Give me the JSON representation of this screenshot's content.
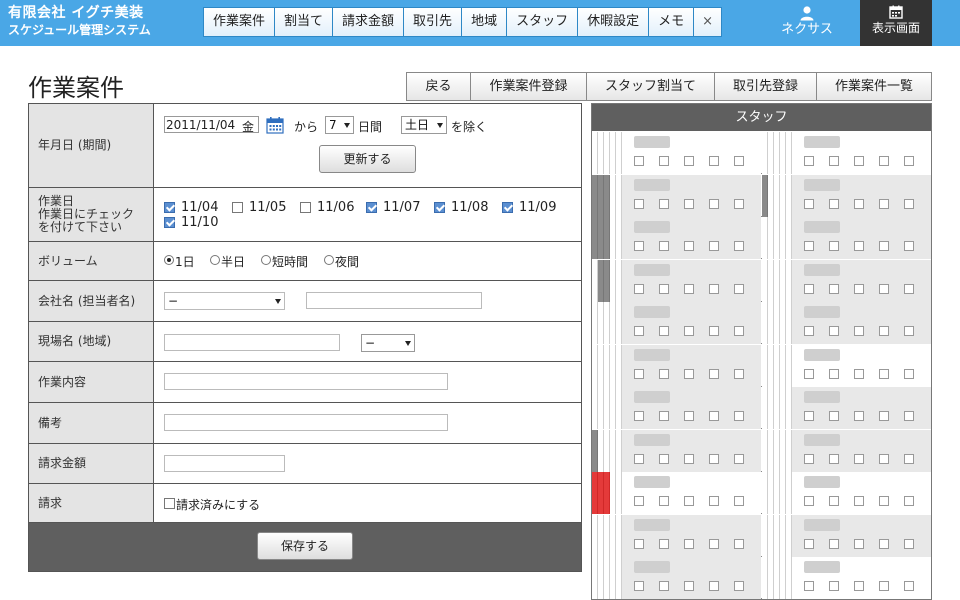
{
  "header": {
    "company": "有限会社 イグチ美装",
    "system": "スケジュール管理システム",
    "nav": [
      "作業案件",
      "割当て",
      "請求金額",
      "取引先",
      "地域",
      "スタッフ",
      "休暇設定",
      "メモ",
      "×"
    ],
    "user": "ネクサス",
    "display_button": "表示画面",
    "colors": {
      "bar": "#4aa7e6",
      "dark": "#333333"
    }
  },
  "page": {
    "title": "作業案件",
    "toolbar": [
      "戻る",
      "作業案件登録",
      "スタッフ割当て",
      "取引先登録",
      "作業案件一覧"
    ]
  },
  "form": {
    "labels": {
      "date": "年月日 (期間)",
      "workday_1": "作業日",
      "workday_2": "作業日にチェック",
      "workday_3": "を付けて下さい",
      "volume": "ボリューム",
      "company": "会社名 (担当者名)",
      "site": "現場名 (地域)",
      "content": "作業内容",
      "note": "備考",
      "amount": "請求金額",
      "billing": "請求"
    },
    "date": {
      "value": "2011/11/04",
      "weekday": "金",
      "from": "から",
      "days": "7",
      "days_unit": "日間",
      "exclude": "土日",
      "exclude_suffix": "を除く",
      "update_button": "更新する"
    },
    "workdays": [
      {
        "label": "11/04",
        "checked": true
      },
      {
        "label": "11/05",
        "checked": false
      },
      {
        "label": "11/06",
        "checked": false
      },
      {
        "label": "11/07",
        "checked": true
      },
      {
        "label": "11/08",
        "checked": true
      },
      {
        "label": "11/09",
        "checked": true
      },
      {
        "label": "11/10",
        "checked": true
      }
    ],
    "volume": [
      {
        "label": "1日",
        "selected": true
      },
      {
        "label": "半日",
        "selected": false
      },
      {
        "label": "短時間",
        "selected": false
      },
      {
        "label": "夜間",
        "selected": false
      }
    ],
    "company_select": "−",
    "site_select": "−",
    "billing_checkbox": "請求済みにする",
    "save_button": "保存する"
  },
  "staff_panel": {
    "title": "スタッフ",
    "checkbox_colors": {
      "dark": "#8a8a8a",
      "red": "#e43a3a"
    },
    "rows": [
      {
        "left": {
          "bars": [
            0,
            0,
            0,
            0,
            0
          ],
          "bg": "white"
        },
        "right": {
          "bars": [
            0,
            0,
            0,
            0,
            0
          ],
          "bg": "white"
        }
      },
      {
        "left": {
          "bars": [
            1,
            1,
            1,
            0,
            0
          ],
          "bg": "gray"
        },
        "right": {
          "bars": [
            1,
            0,
            0,
            0,
            0
          ],
          "bg": "gray"
        }
      },
      {
        "left": {
          "bars": [
            1,
            1,
            1,
            0,
            0
          ],
          "bg": "gray"
        },
        "right": {
          "bars": [
            0,
            0,
            0,
            0,
            0
          ],
          "bg": "gray"
        }
      },
      {
        "left": {
          "bars": [
            0,
            1,
            1,
            0,
            0
          ],
          "bg": "gray"
        },
        "right": {
          "bars": [
            0,
            0,
            0,
            0,
            0
          ],
          "bg": "gray"
        }
      },
      {
        "left": {
          "bars": [
            0,
            0,
            0,
            0,
            0
          ],
          "bg": "gray"
        },
        "right": {
          "bars": [
            0,
            0,
            0,
            0,
            0
          ],
          "bg": "gray"
        }
      },
      {
        "left": {
          "bars": [
            0,
            0,
            0,
            0,
            0
          ],
          "bg": "gray"
        },
        "right": {
          "bars": [
            0,
            0,
            0,
            0,
            0
          ],
          "bg": "white"
        }
      },
      {
        "left": {
          "bars": [
            0,
            0,
            0,
            0,
            0
          ],
          "bg": "gray"
        },
        "right": {
          "bars": [
            0,
            0,
            0,
            0,
            0
          ],
          "bg": "gray"
        }
      },
      {
        "left": {
          "bars": [
            1,
            0,
            0,
            0,
            0
          ],
          "bg": "gray"
        },
        "right": {
          "bars": [
            0,
            0,
            0,
            0,
            0
          ],
          "bg": "gray"
        }
      },
      {
        "left": {
          "bars": [
            2,
            2,
            2,
            0,
            0
          ],
          "bg": "white"
        },
        "right": {
          "bars": [
            0,
            0,
            0,
            0,
            0
          ],
          "bg": "white"
        }
      },
      {
        "left": {
          "bars": [
            0,
            0,
            0,
            0,
            0
          ],
          "bg": "gray"
        },
        "right": {
          "bars": [
            0,
            0,
            0,
            0,
            0
          ],
          "bg": "gray"
        }
      },
      {
        "left": {
          "bars": [
            0,
            0,
            0,
            0,
            0
          ],
          "bg": "gray"
        },
        "right": {
          "bars": [
            0,
            0,
            0,
            0,
            0
          ],
          "bg": "white"
        }
      }
    ]
  }
}
